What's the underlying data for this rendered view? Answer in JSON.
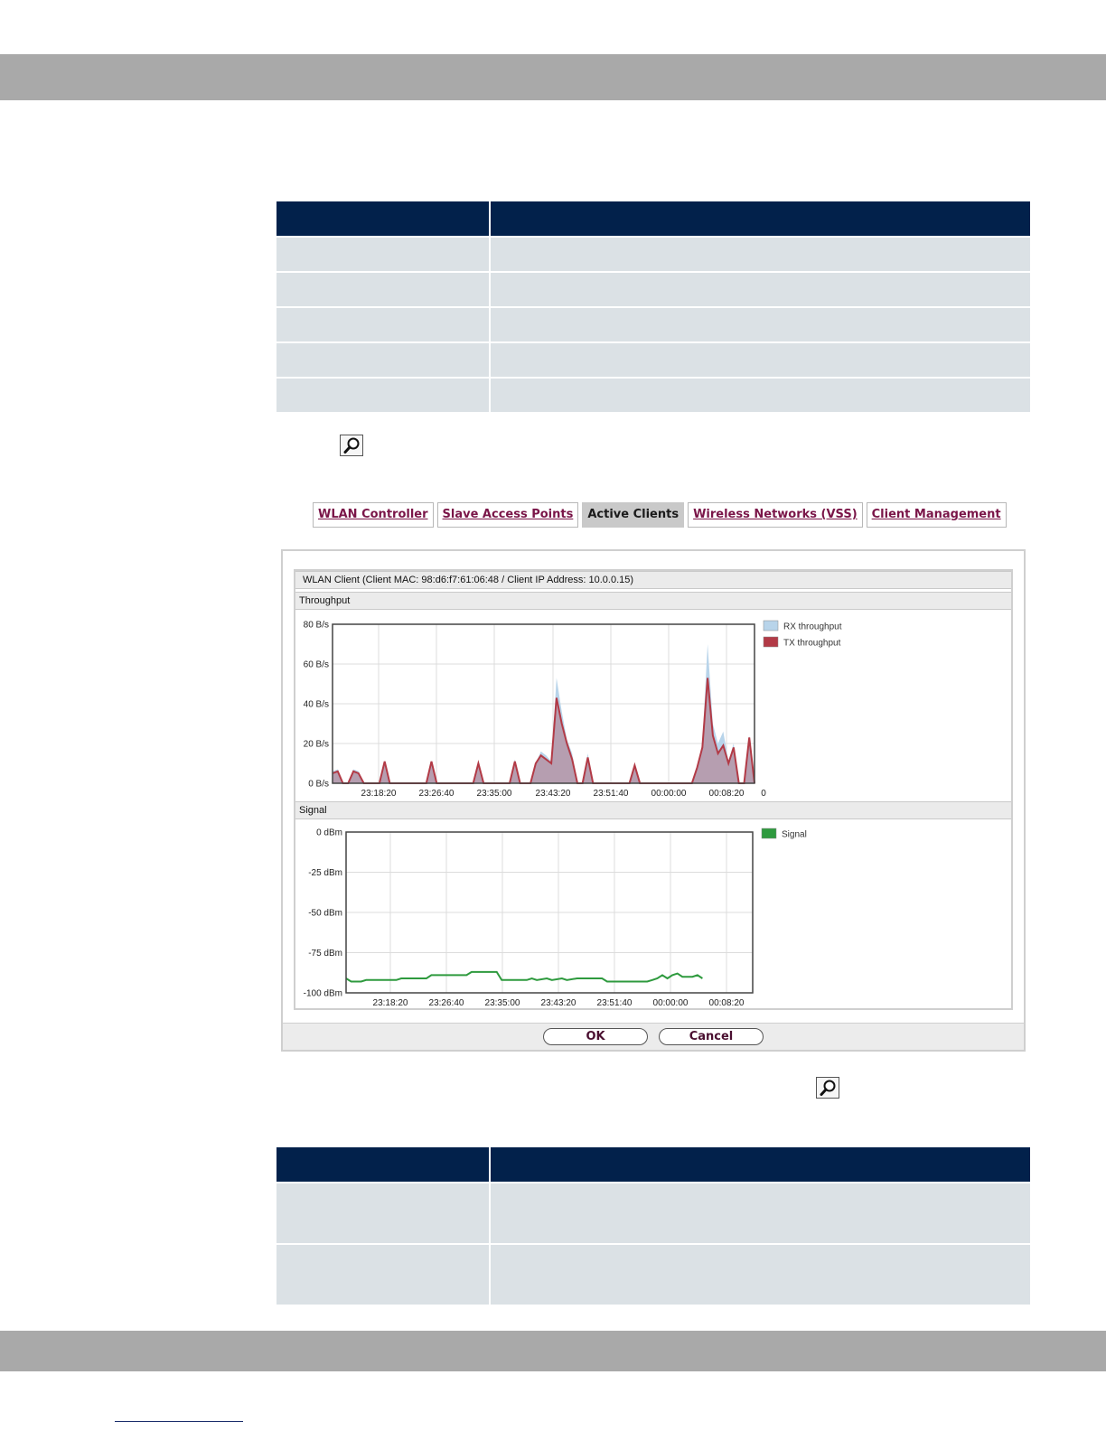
{
  "dialog": {
    "tabs": [
      {
        "label": "WLAN Controller",
        "active": false
      },
      {
        "label": "Slave Access Points",
        "active": false
      },
      {
        "label": "Active Clients",
        "active": true
      },
      {
        "label": "Wireless Networks (VSS)",
        "active": false
      },
      {
        "label": "Client Management",
        "active": false
      }
    ],
    "title": "WLAN Client (Client MAC: 98:d6:f7:61:06:48 / Client IP Address: 10.0.0.15)",
    "throughput_section": "Throughput",
    "signal_section": "Signal",
    "ok_label": "OK",
    "cancel_label": "Cancel"
  },
  "icons": {
    "magnifier": "magnifier-icon"
  },
  "colors": {
    "table_header": "#02214b",
    "table_row": "#dbe1e5",
    "band": "#a9a9a9",
    "rx": "#b8d4ea",
    "tx": "#b23a46",
    "signal": "#2e9a3e"
  },
  "chart_data": [
    {
      "type": "area",
      "x_ticks": [
        "23:18:20",
        "23:26:40",
        "23:35:00",
        "23:43:20",
        "23:51:40",
        "00:00:00",
        "00:08:20"
      ],
      "y_ticks": [
        "80 B/s",
        "60 B/s",
        "40 B/s",
        "20 B/s",
        "0 B/s"
      ],
      "ylim": [
        0,
        80
      ],
      "x_end_label": "0",
      "grid": true,
      "legend_position": "right",
      "series": [
        {
          "name": "RX throughput",
          "color": "#b8d4ea",
          "points": [
            [
              0,
              6
            ],
            [
              1,
              7
            ],
            [
              2,
              0
            ],
            [
              3,
              0
            ],
            [
              4,
              7
            ],
            [
              5,
              6
            ],
            [
              6,
              0
            ],
            [
              9,
              0
            ],
            [
              10,
              11
            ],
            [
              11,
              0
            ],
            [
              18,
              0
            ],
            [
              19,
              11
            ],
            [
              20,
              0
            ],
            [
              27,
              0
            ],
            [
              28,
              11
            ],
            [
              29,
              0
            ],
            [
              34,
              0
            ],
            [
              35,
              12
            ],
            [
              36,
              0
            ],
            [
              38,
              0
            ],
            [
              39,
              10
            ],
            [
              40,
              16
            ],
            [
              41,
              14
            ],
            [
              42,
              11
            ],
            [
              43,
              53
            ],
            [
              44,
              36
            ],
            [
              45,
              22
            ],
            [
              46,
              15
            ],
            [
              47,
              0
            ],
            [
              48,
              0
            ],
            [
              49,
              15
            ],
            [
              50,
              0
            ],
            [
              57,
              0
            ],
            [
              58,
              9
            ],
            [
              59,
              0
            ],
            [
              69,
              0
            ],
            [
              70,
              8
            ],
            [
              71,
              20
            ],
            [
              72,
              70
            ],
            [
              73,
              30
            ],
            [
              74,
              20
            ],
            [
              75,
              26
            ],
            [
              76,
              11
            ],
            [
              77,
              20
            ],
            [
              78,
              0
            ],
            [
              79,
              0
            ],
            [
              80,
              24
            ],
            [
              81,
              0
            ]
          ]
        },
        {
          "name": "TX throughput",
          "color": "#b23a46",
          "points": [
            [
              0,
              5
            ],
            [
              1,
              6
            ],
            [
              2,
              0
            ],
            [
              3,
              0
            ],
            [
              4,
              6
            ],
            [
              5,
              5
            ],
            [
              6,
              0
            ],
            [
              9,
              0
            ],
            [
              10,
              11
            ],
            [
              11,
              0
            ],
            [
              18,
              0
            ],
            [
              19,
              11
            ],
            [
              20,
              0
            ],
            [
              27,
              0
            ],
            [
              28,
              10
            ],
            [
              29,
              0
            ],
            [
              34,
              0
            ],
            [
              35,
              11
            ],
            [
              36,
              0
            ],
            [
              38,
              0
            ],
            [
              39,
              10
            ],
            [
              40,
              14
            ],
            [
              41,
              12
            ],
            [
              42,
              10
            ],
            [
              43,
              43
            ],
            [
              44,
              30
            ],
            [
              45,
              20
            ],
            [
              46,
              12
            ],
            [
              47,
              0
            ],
            [
              48,
              0
            ],
            [
              49,
              13
            ],
            [
              50,
              0
            ],
            [
              57,
              0
            ],
            [
              58,
              9
            ],
            [
              59,
              0
            ],
            [
              69,
              0
            ],
            [
              70,
              8
            ],
            [
              71,
              18
            ],
            [
              72,
              53
            ],
            [
              73,
              24
            ],
            [
              74,
              15
            ],
            [
              75,
              19
            ],
            [
              76,
              10
            ],
            [
              77,
              18
            ],
            [
              78,
              0
            ],
            [
              79,
              0
            ],
            [
              80,
              23
            ],
            [
              81,
              0
            ]
          ]
        }
      ]
    },
    {
      "type": "line",
      "x_ticks": [
        "23:18:20",
        "23:26:40",
        "23:35:00",
        "23:43:20",
        "23:51:40",
        "00:00:00",
        "00:08:20"
      ],
      "y_ticks": [
        "0 dBm",
        "-25 dBm",
        "-50 dBm",
        "-75 dBm",
        "-100 dBm"
      ],
      "ylim": [
        -100,
        0
      ],
      "grid": true,
      "legend_position": "right",
      "series": [
        {
          "name": "Signal",
          "color": "#2e9a3e",
          "points": [
            [
              0,
              -91
            ],
            [
              1,
              -93
            ],
            [
              3,
              -93
            ],
            [
              4,
              -92
            ],
            [
              10,
              -92
            ],
            [
              11,
              -91
            ],
            [
              16,
              -91
            ],
            [
              17,
              -89
            ],
            [
              24,
              -89
            ],
            [
              25,
              -87
            ],
            [
              30,
              -87
            ],
            [
              31,
              -92
            ],
            [
              36,
              -92
            ],
            [
              37,
              -91
            ],
            [
              38,
              -92
            ],
            [
              40,
              -91
            ],
            [
              41,
              -92
            ],
            [
              43,
              -91
            ],
            [
              44,
              -92
            ],
            [
              46,
              -91
            ],
            [
              51,
              -91
            ],
            [
              52,
              -93
            ],
            [
              60,
              -93
            ],
            [
              61,
              -92
            ],
            [
              62,
              -91
            ],
            [
              63,
              -89
            ],
            [
              64,
              -91
            ],
            [
              65,
              -89
            ],
            [
              66,
              -88
            ],
            [
              67,
              -90
            ],
            [
              69,
              -90
            ],
            [
              70,
              -89
            ],
            [
              71,
              -91
            ]
          ]
        }
      ]
    }
  ]
}
